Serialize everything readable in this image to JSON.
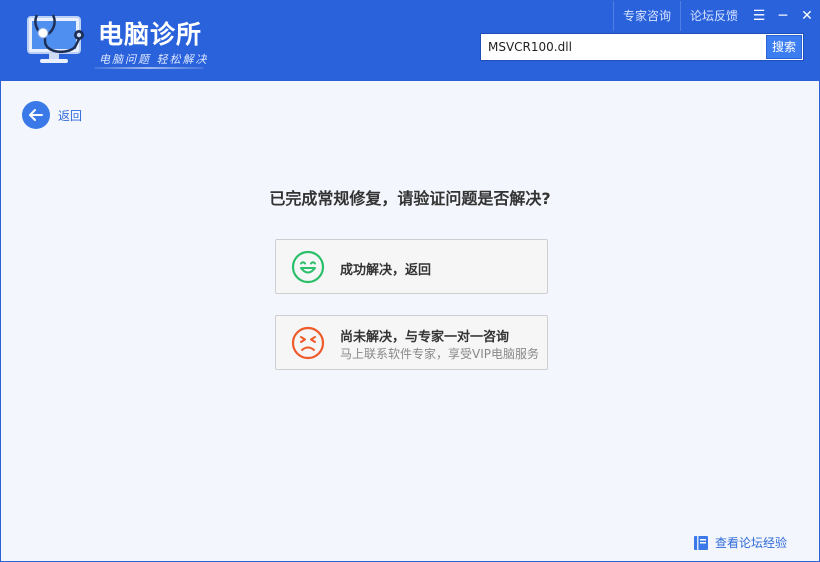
{
  "app": {
    "title": "电脑诊所",
    "slogan": "电脑问题 轻松解决"
  },
  "toplinks": {
    "expert": "专家咨询",
    "feedback": "论坛反馈"
  },
  "search": {
    "value": "MSVCR100.dll",
    "button": "搜索"
  },
  "back": {
    "label": "返回"
  },
  "question": "已完成常规修复，请验证问题是否解决?",
  "options": [
    {
      "title": "成功解决，返回",
      "icon": "smile-icon",
      "color": "#2bbf6a"
    },
    {
      "title": "尚未解决，与专家一对一咨询",
      "subtitle": "马上联系软件专家，享受VIP电脑服务",
      "icon": "frown-icon",
      "color": "#ee5a2a"
    }
  ],
  "forum": {
    "label": "查看论坛经验",
    "icon": "book-icon"
  },
  "colors": {
    "header": "#2a62dc",
    "accent": "#3b79e8",
    "background": "#f3f6fc"
  }
}
